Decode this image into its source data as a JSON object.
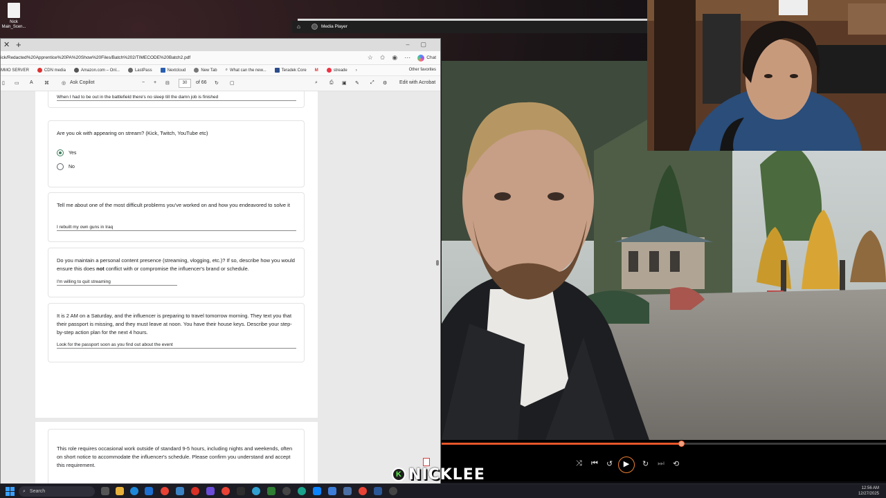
{
  "desktop": {
    "icon_label_1": "Nick",
    "icon_label_2": "Main_Scen..."
  },
  "browser": {
    "url": "ick/Redacted%20Apprentice%20PA%20Show%20Files/Batch%202/TIMECODE%20Batch2.pdf",
    "chat_label": "Chat",
    "favorites": [
      "MMO SERVER",
      "CDN media",
      "Amazon.com – Onl...",
      "LastPass",
      "Nextcloud",
      "New Tab",
      "What can the new...",
      "Teradek Core",
      "M",
      "streade"
    ],
    "other_favorites": "Other favorites",
    "toolbar": {
      "ask_copilot": "Ask Copilot",
      "page_current": "30",
      "page_total": "of 66",
      "edit_with_acrobat": "Edit with Acrobat"
    }
  },
  "form": {
    "prev_answer": "When I had to be out in the battlefield there's no sleep till the damn job is finished",
    "q_stream": "Are you ok with appearing on stream? (Kick, Twitch, YouTube etc)",
    "option_yes": "Yes",
    "option_no": "No",
    "selected_option": "Yes",
    "q_problems": "Tell me about one of the most difficult problems you've worked on and how you endeavored to solve it",
    "a_problems": "I rebuilt my own guns in Iraq",
    "q_presence_1": "Do you maintain a personal content presence (streaming, vlogging, etc.)? If so, describe how you would ensure this does ",
    "q_presence_bold": "not",
    "q_presence_2": " conflict with or compromise the influencer's brand or schedule.",
    "a_presence": "I'm willing to quit streaming",
    "q_passport": "It is 2 AM on a Saturday, and the influencer is preparing to travel tomorrow morning. They text you that their passport is missing, and they must leave at noon. You have their house keys. Describe your step-by-step action plan for the next 4 hours.",
    "a_passport": "Look for the passport soon as you find out about the event",
    "q_hours": "This role requires occasional work outside of standard 9-5 hours, including nights and weekends, often on short notice to accommodate the influencer's schedule. Please confirm you understand and accept this requirement."
  },
  "media_player": {
    "title": "Media Player",
    "progress": 0.54,
    "accent": "#e8562b"
  },
  "streamer": {
    "badge": "K",
    "name": "NICKLEE"
  },
  "taskbar": {
    "search_placeholder": "Search",
    "time": "12:56 AM",
    "date": "12/27/2025"
  }
}
